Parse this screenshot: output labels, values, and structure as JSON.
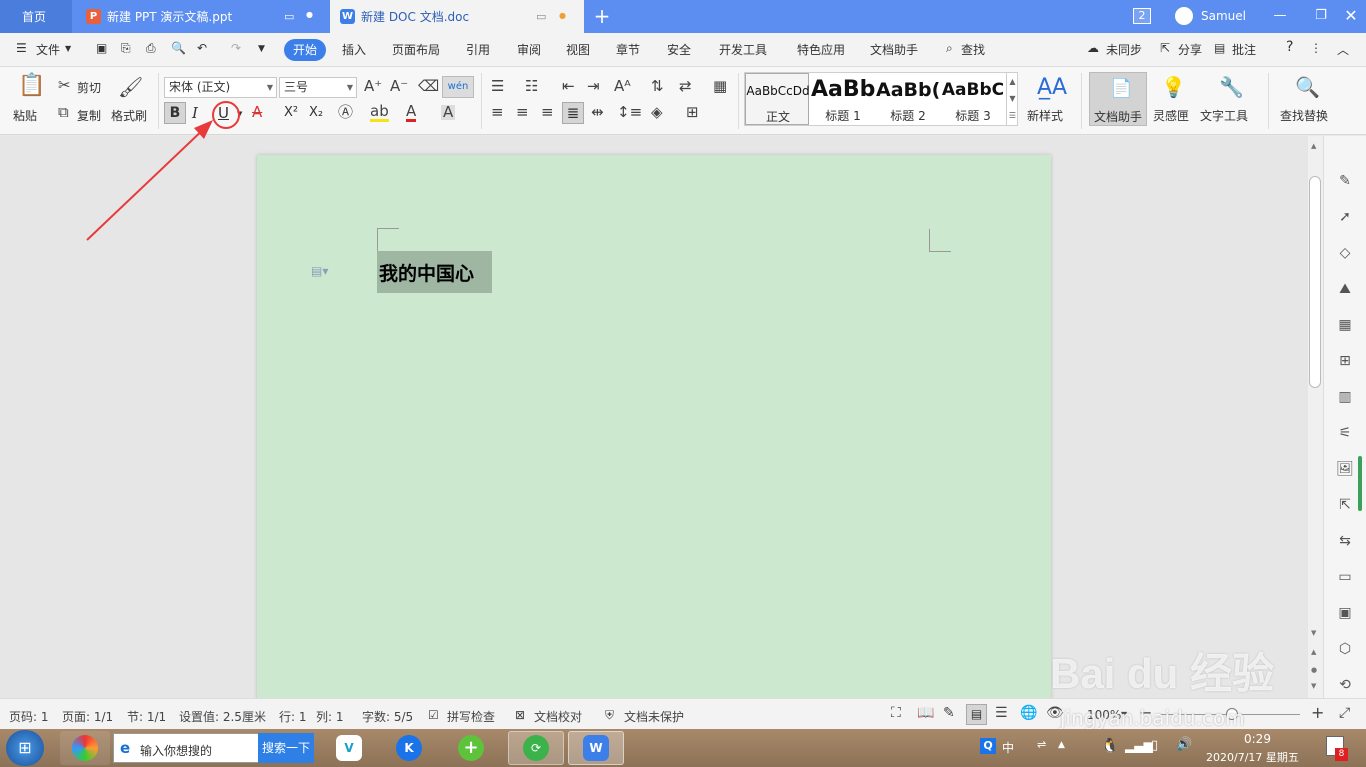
{
  "titlebar": {
    "tabs": [
      {
        "label": "首页",
        "icon": "home-tab"
      },
      {
        "label": "新建 PPT 演示文稿.ppt",
        "icon": "ppt-icon"
      },
      {
        "label": "新建 DOC 文档.doc",
        "icon": "doc-icon"
      }
    ],
    "window_count": "2",
    "user": "Samuel"
  },
  "menubar": {
    "file": "文件",
    "tabs": [
      "开始",
      "插入",
      "页面布局",
      "引用",
      "审阅",
      "视图",
      "章节",
      "安全",
      "开发工具",
      "特色应用",
      "文档助手"
    ],
    "search": "查找",
    "sync": "未同步",
    "share": "分享",
    "comment": "批注",
    "help": "?"
  },
  "ribbon": {
    "paste": "粘贴",
    "cut": "剪切",
    "copy": "复制",
    "format_painter": "格式刷",
    "font_name": "宋体 (正文)",
    "font_size": "三号",
    "bold": "B",
    "italic": "I",
    "underline": "U",
    "superscript": "X²",
    "subscript": "X₂",
    "pinyin": "wén",
    "styles": [
      {
        "preview": "AaBbCcDd",
        "label": "正文"
      },
      {
        "preview": "AaBb",
        "label": "标题 1"
      },
      {
        "preview": "AaBb(",
        "label": "标题 2"
      },
      {
        "preview": "AaBbC",
        "label": "标题 3"
      }
    ],
    "new_style": "新样式",
    "doc_assistant": "文档助手",
    "inspiration": "灵感匣",
    "text_tools": "文字工具",
    "find_replace": "查找替换"
  },
  "document": {
    "heading": "我的中国心"
  },
  "statusbar": {
    "page_num": "页码: 1",
    "pages": "页面: 1/1",
    "section": "节: 1/1",
    "setting": "设置值: 2.5厘米",
    "row": "行: 1",
    "col": "列: 1",
    "words": "字数: 5/5",
    "spell": "拼写检查",
    "proof": "文档校对",
    "protect": "文档未保护",
    "zoom": "100%"
  },
  "taskbar": {
    "search_placeholder": "输入你想搜的",
    "search_button": "搜索一下",
    "time": "0:29",
    "date": "2020/7/17 星期五",
    "ime": "中",
    "badge": "8"
  },
  "watermark": {
    "text": "jingyan.baidu.com",
    "brand": "Bai du 经验"
  },
  "colors": {
    "titlebar": "#5b8ef0",
    "accent": "#3d7fe9",
    "page": "#cce8cf",
    "highlight": "#9fb6a3",
    "annotation": "#e83a3a"
  }
}
